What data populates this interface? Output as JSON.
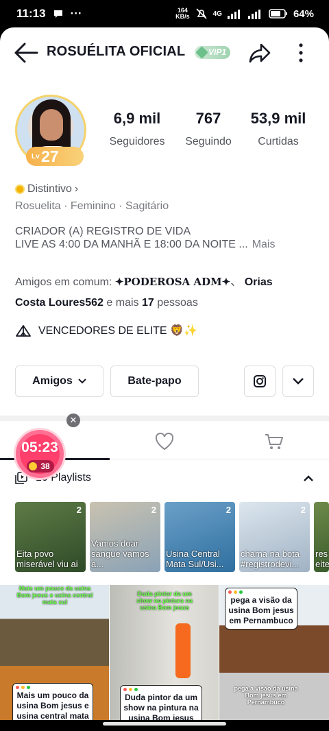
{
  "status_bar": {
    "time": "11:13",
    "net_speed_value": "164",
    "net_speed_unit": "KB/s",
    "network": "4G",
    "battery": "64%"
  },
  "header": {
    "title": "ROSUÉLITA OFICIAL",
    "vip_label": "VIP1"
  },
  "profile": {
    "level_prefix": "Lv",
    "level": "27",
    "stats": [
      {
        "value": "6,9 mil",
        "label": "Seguidores"
      },
      {
        "value": "767",
        "label": "Seguindo"
      },
      {
        "value": "53,9 mil",
        "label": "Curtidas"
      }
    ],
    "distintivo_label": "Distintivo",
    "meta": "Rosuelita · Feminino · Sagitário",
    "bio_line1": "CRIADOR (A) REGISTRO DE VIDA",
    "bio_line2": "LIVE AS 4:00 DA MANHÃ E 18:00 DA NOITE ...",
    "bio_more": "Mais",
    "friends_prefix": "Amigos em comum:",
    "friend1": "✦PODEROSA ADM✦",
    "friend_sep": "、",
    "friend2a": "Orias",
    "friend2b": "Costa Loures562",
    "friends_and_more": "e mais",
    "friends_count": "17",
    "friends_suffix": "pessoas",
    "group_name": "VENCEDORES DE ELITE 🦁✨"
  },
  "actions": {
    "friends_button": "Amigos",
    "chat_button": "Bate-papo"
  },
  "live_timer": {
    "time": "05:23",
    "coins": "38"
  },
  "playlists": {
    "label": "10 Playlists",
    "items": [
      {
        "count": "2",
        "caption": "Eita povo miserável viu ai",
        "c1": "#4c6b3a",
        "c2": "#8a9d6e"
      },
      {
        "count": "2",
        "caption": "Vamos doar sangue vamos a...",
        "c1": "#8aa2b6",
        "c2": "#c9c2b0"
      },
      {
        "count": "2",
        "caption": "Usina Central Mata Sul/Usi...",
        "banner": "Sul/Usina Bom Jesus Pernambuco",
        "c1": "#2f7fbf",
        "c2": "#6aa0c8"
      },
      {
        "count": "2",
        "caption": "chama na bota #registrodevi...",
        "c1": "#c7d7e6",
        "c2": "#a0b2c4"
      },
      {
        "count": "",
        "caption": "res eite",
        "c1": "#3a5d2c",
        "c2": "#6f8a4a"
      }
    ]
  },
  "videos": [
    {
      "top_text": "Mais um pouco da usina Bom jesus e usina central mata sul",
      "card": "Mais um pouco da usina Bom jesus e usina central mata"
    },
    {
      "top_text": "Duda pintor da um show na pintura na usina Bom jesus",
      "card": "Duda pintor da um show na pintura na usina Bom jesus"
    },
    {
      "top_text": "",
      "card": "pega a visão da usina Bom jesus em Pernambuco",
      "overlay": "pega a visão da usina Bom jesus em Pernambuco"
    }
  ],
  "colors": {
    "text_primary": "#161823",
    "text_secondary": "#55575e",
    "timer_pink": "#ff3f6c",
    "vip_green": "#9fd3b0"
  }
}
